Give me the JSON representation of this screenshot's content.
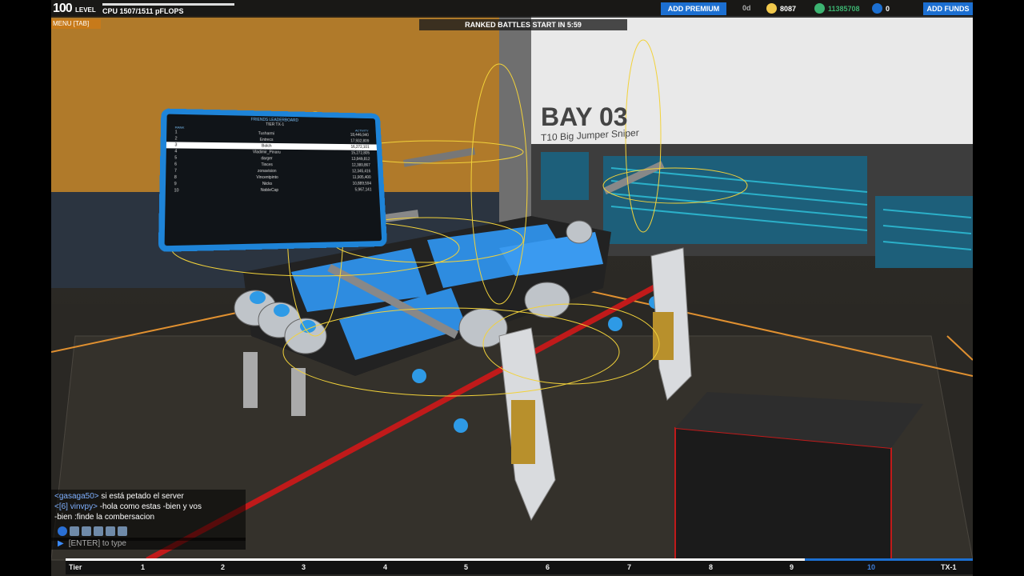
{
  "hud": {
    "level": "100",
    "level_word": "LEVEL",
    "cpu": "CPU 1507/1511 pFLOPS",
    "cpu_progress": 0.997,
    "menu_tab": "MENU [TAB]",
    "ranked_text": "RANKED BATTLES START IN 5:59",
    "add_premium": "ADD PREMIUM",
    "premium_days": "0d",
    "robits_1": "8087",
    "robits_2": "11385708",
    "cosmetic_credits": "0",
    "add_funds": "ADD FUNDS"
  },
  "bay": {
    "title": "BAY 03",
    "subtitle": "T10 Big Jumper Sniper"
  },
  "leaderboard": {
    "title": "FRIENDS LEADERBOARD",
    "tier": "TIER TX-1",
    "col_rank": "RANK",
    "col_score": "ACTIVITY",
    "rows": [
      {
        "rank": "1",
        "name": "Tusharmi",
        "score": "18,446,940"
      },
      {
        "rank": "2",
        "name": "Entrecs",
        "score": "17,932,809"
      },
      {
        "rank": "3",
        "name": "Bolch",
        "score": "16,272,101"
      },
      {
        "rank": "4",
        "name": "Vladimir_Pinaru",
        "score": "15,272,805"
      },
      {
        "rank": "5",
        "name": "darger",
        "score": "13,849,812"
      },
      {
        "rank": "6",
        "name": "Tinces",
        "score": "12,380,867"
      },
      {
        "rank": "7",
        "name": "zonavision",
        "score": "12,345,416"
      },
      {
        "rank": "8",
        "name": "Vincentpinto",
        "score": "11,905,400"
      },
      {
        "rank": "9",
        "name": "Nicks",
        "score": "10,889,594"
      },
      {
        "rank": "10",
        "name": "NobleCap",
        "score": "5,967,141"
      }
    ]
  },
  "chat": {
    "lines": [
      {
        "name": "<gasaga50>",
        "text": " si está petado el server"
      },
      {
        "name": "<[6] vinvpy>",
        "text": " -hola como estas -bien y vos"
      },
      {
        "name": "",
        "text": "-bien :finde la combersacion"
      }
    ],
    "input_placeholder": "[ENTER] to type"
  },
  "tier_bar": {
    "label": "Tier",
    "ticks": [
      "1",
      "2",
      "3",
      "4",
      "5",
      "6",
      "7",
      "8",
      "9",
      "10"
    ],
    "end_label": "TX-1",
    "progress": 0.815
  },
  "colors": {
    "accent_blue": "#1c6fd1",
    "menu_orange": "#c77a1a",
    "gold": "#f2c94c",
    "green": "#3cb371"
  }
}
